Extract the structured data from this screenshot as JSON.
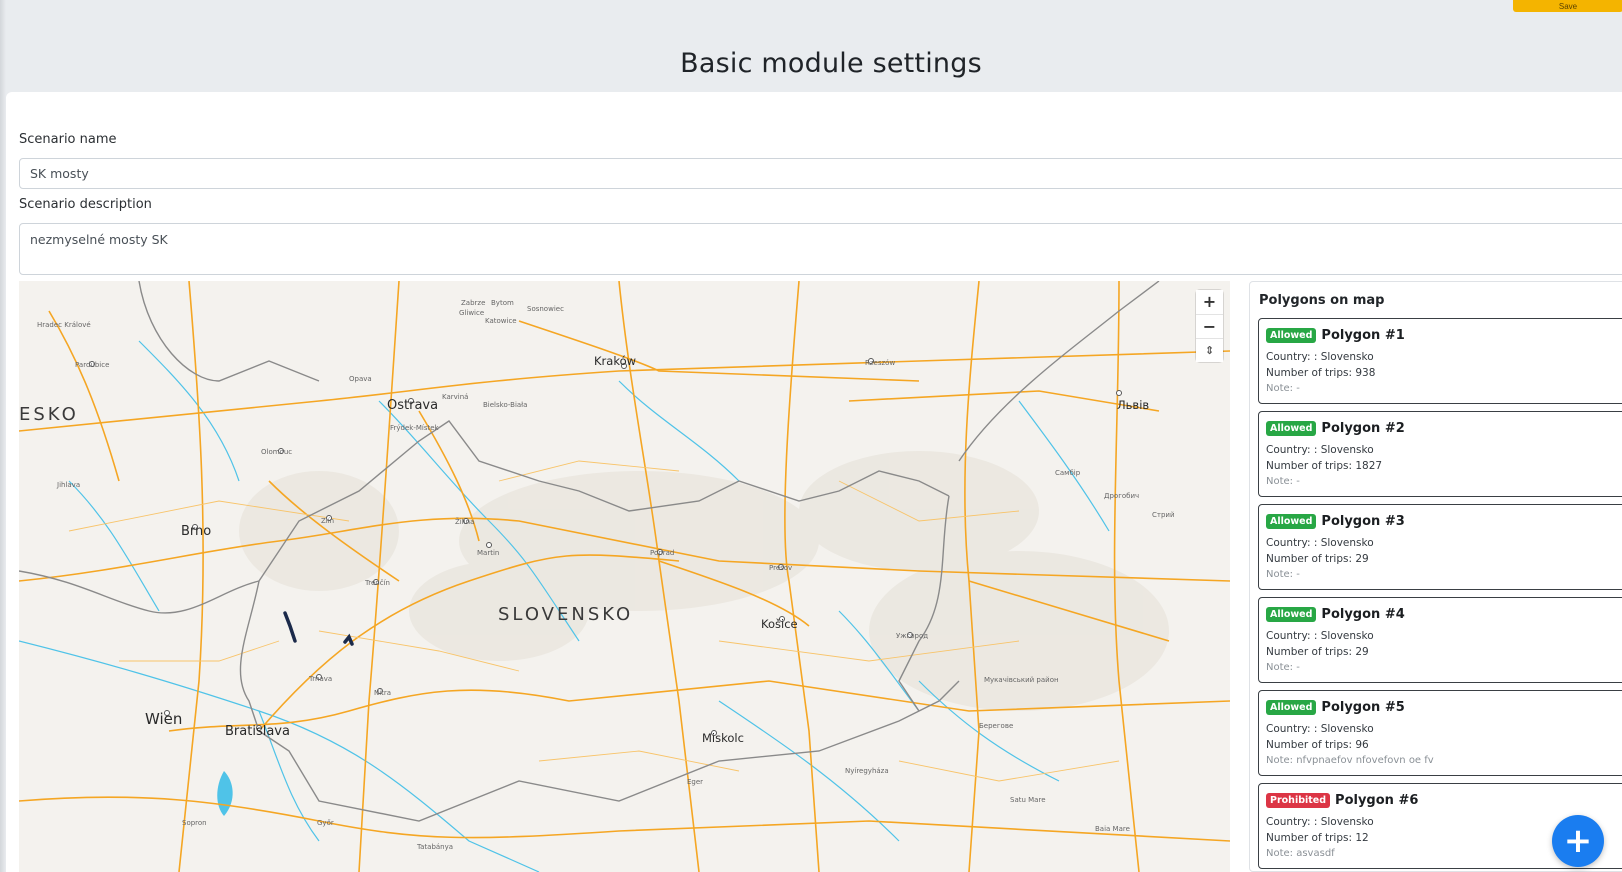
{
  "header": {
    "top_button_label": "Save",
    "title": "Basic module settings"
  },
  "form": {
    "scenario_name_label": "Scenario name",
    "scenario_name_value": "SK mosty",
    "scenario_description_label": "Scenario description",
    "scenario_description_value": "nezmyselné mosty SK"
  },
  "map": {
    "zoom_in": "+",
    "zoom_out": "−",
    "reset_north": "⇕",
    "labels": {
      "country": "SLOVENSKO",
      "country_left": "ESKO",
      "krakow": "Kraków",
      "ostrava": "Ostrava",
      "brno": "Brno",
      "wien": "Wien",
      "bratislava": "Bratislava",
      "kosice": "Košice",
      "miskolc": "Miskolc",
      "lviv": "Львів",
      "hradec": "Hradec Králové",
      "pardubice": "Pardubice",
      "olomouc": "Olomouc",
      "jihlava": "Jihlava",
      "zlin": "Zlín",
      "zilina": "Žilina",
      "trencin": "Trenčín",
      "trnava": "Trnava",
      "nitra": "Nitra",
      "martin": "Martin",
      "poprad": "Poprad",
      "presov": "Prešov",
      "uzhorod": "Ужгород",
      "rzeszow": "Rzeszów",
      "katowice": "Katowice",
      "bielsko": "Bielsko-Biała",
      "frydek": "Frýdek-Místek",
      "opava": "Opava",
      "karvina": "Karviná",
      "zabrze": "Zabrze",
      "gliwice": "Gliwice",
      "bytom": "Bytom",
      "sosnowiec": "Sosnowiec",
      "gyor": "Győr",
      "sopron": "Sopron",
      "tatabanya": "Tatabánya",
      "eger": "Eger",
      "nyiregyhaza": "Nyíregyháza",
      "satu_mare": "Satu Mare",
      "baia_mare": "Baia Mare",
      "mukachevo": "Мукачівський район",
      "berehove": "Берегове",
      "sambir": "Самбір",
      "stryi": "Стрий",
      "drohobych": "Дрогобич"
    }
  },
  "polygons": {
    "title": "Polygons on map",
    "items": [
      {
        "status": "Allowed",
        "name": "Polygon #1",
        "country": "Country: : Slovensko",
        "trips": "Number of trips: 938",
        "note": "Note: -"
      },
      {
        "status": "Allowed",
        "name": "Polygon #2",
        "country": "Country: : Slovensko",
        "trips": "Number of trips: 1827",
        "note": "Note: -"
      },
      {
        "status": "Allowed",
        "name": "Polygon #3",
        "country": "Country: : Slovensko",
        "trips": "Number of trips: 29",
        "note": "Note: -"
      },
      {
        "status": "Allowed",
        "name": "Polygon #4",
        "country": "Country: : Slovensko",
        "trips": "Number of trips: 29",
        "note": "Note: -"
      },
      {
        "status": "Allowed",
        "name": "Polygon #5",
        "country": "Country: : Slovensko",
        "trips": "Number of trips: 96",
        "note": "Note: nfvpnaefov nfovefovn oe fv"
      },
      {
        "status": "Prohibited",
        "name": "Polygon #6",
        "country": "Country: : Slovensko",
        "trips": "Number of trips: 12",
        "note": "Note: asvasdf"
      }
    ]
  },
  "fab_label": "+",
  "colors": {
    "allowed": "#28a745",
    "prohibited": "#dc3545",
    "fab": "#1a7df0",
    "road": "#f5a623",
    "water": "#4fc3e8",
    "border": "#8a8a8a"
  }
}
